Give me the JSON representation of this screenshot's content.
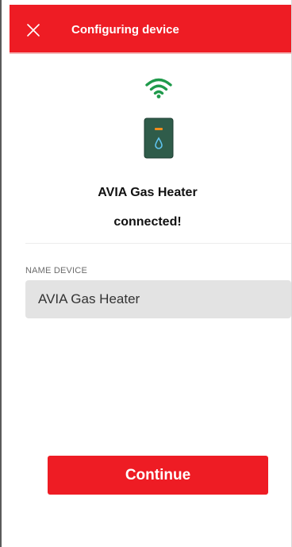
{
  "header": {
    "title": "Configuring device",
    "close_icon": "close-icon",
    "background_color": "#ee1c24"
  },
  "status": {
    "wifi_icon": "wifi-icon",
    "wifi_color": "#1f9a4b",
    "device_icon": "gas-heater-icon",
    "device_name": "AVIA Gas Heater",
    "connection_text": "connected!"
  },
  "form": {
    "name_label": "NAME DEVICE",
    "name_value": "AVIA Gas Heater"
  },
  "actions": {
    "continue_label": "Continue",
    "accent_color": "#ee1c24"
  }
}
